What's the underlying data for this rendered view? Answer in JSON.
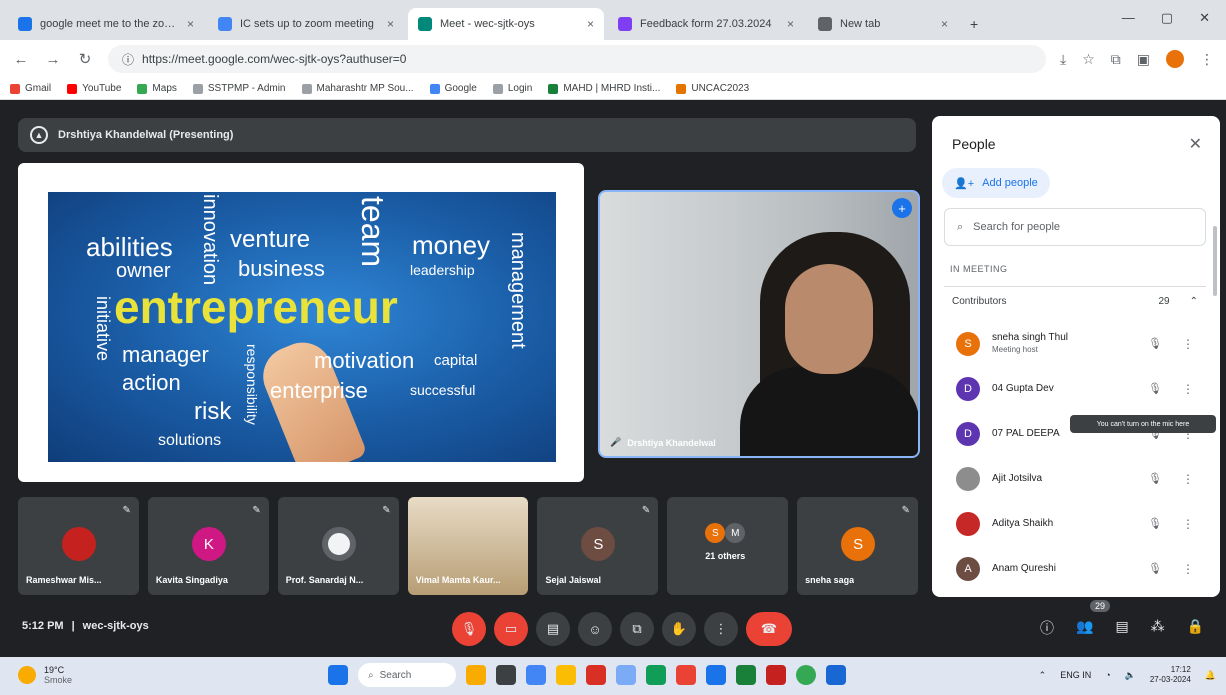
{
  "browser": {
    "tabs": [
      {
        "title": "google meet me to the zoom",
        "color": "#1a73e8",
        "active": false
      },
      {
        "title": "IC sets up to zoom meeting",
        "color": "#4285f4",
        "active": false
      },
      {
        "title": "Meet - wec-sjtk-oys",
        "color": "#00897b",
        "active": true
      },
      {
        "title": "Feedback form 27.03.2024",
        "color": "#7e3ff2",
        "active": false
      },
      {
        "title": "New tab",
        "color": "#5f6368",
        "active": false
      }
    ],
    "new_tab": "+",
    "url": "https://meet.google.com/wec-sjtk-oys?authuser=0",
    "bookmarks": [
      "Gmail",
      "YouTube",
      "Maps",
      "SSTPMP - Admin",
      "Maharashtr MP Sou...",
      "Google",
      "Login",
      "MAHD | MHRD Insti...",
      "UNCAC2023"
    ]
  },
  "meet": {
    "presenter_label": "Drshtiya Khandelwal (Presenting)",
    "slide_words": {
      "abilities": "abilities",
      "owner": "owner",
      "innovation": "innovation",
      "venture": "venture",
      "business": "business",
      "team": "team",
      "money": "money",
      "leadership": "leadership",
      "management": "management",
      "entrepreneur": "entrepreneur",
      "initiative": "initiative",
      "manager": "manager",
      "action": "action",
      "responsibility": "responsibility",
      "motivation": "motivation",
      "capital": "capital",
      "enterprise": "enterprise",
      "successful": "successful",
      "risk": "risk",
      "solutions": "solutions"
    },
    "video_name": "Drshtiya Khandelwal",
    "participants": [
      {
        "name": "Rameshwar Mis...",
        "initial": "",
        "color": "#c5221f",
        "type": "photo"
      },
      {
        "name": "Kavita Singadiya",
        "initial": "K",
        "color": "#d01884",
        "type": "letter"
      },
      {
        "name": "Prof. Sanardaj N...",
        "initial": "",
        "color": "#f1f3f4",
        "type": "photo"
      },
      {
        "name": "Vimal Mamta Kaur...",
        "initial": "",
        "color": "#c9b28a",
        "type": "photo"
      },
      {
        "name": "Sejal Jaiswal",
        "initial": "S",
        "color": "#6d4c41",
        "type": "letter"
      },
      {
        "name": "21 others",
        "initial": "",
        "color": "#3c4043",
        "type": "others"
      },
      {
        "name": "sneha saga",
        "initial": "S",
        "color": "#e8710a",
        "type": "letter"
      }
    ],
    "time": "5:12 PM",
    "meeting_code": "wec-sjtk-oys",
    "participant_count": "29"
  },
  "people_panel": {
    "title": "People",
    "add_people": "Add people",
    "search_placeholder": "Search for people",
    "section": "IN MEETING",
    "contributors_label": "Contributors",
    "contributors_count": "29",
    "people": [
      {
        "name": "sneha singh Thul",
        "sub": "Meeting host",
        "initial": "S",
        "color": "#e8710a"
      },
      {
        "name": "04 Gupta Dev",
        "sub": "",
        "initial": "D",
        "color": "#5e35b1"
      },
      {
        "name": "07 PAL DEEPA",
        "sub": "",
        "initial": "D",
        "color": "#5e35b1"
      },
      {
        "name": "Ajit Jotsilva",
        "sub": "",
        "initial": "",
        "color": "#8d8d8d"
      },
      {
        "name": "Aditya Shaikh",
        "sub": "",
        "initial": "",
        "color": "#c62828"
      },
      {
        "name": "Anam Qureshi",
        "sub": "",
        "initial": "A",
        "color": "#6d4c41"
      }
    ],
    "tooltip": "You can't turn on the mic here"
  },
  "taskbar": {
    "weather_temp": "19°C",
    "weather_desc": "Smoke",
    "search_label": "Search",
    "lang": "ENG IN",
    "time": "17:12",
    "date": "27-03-2024"
  }
}
